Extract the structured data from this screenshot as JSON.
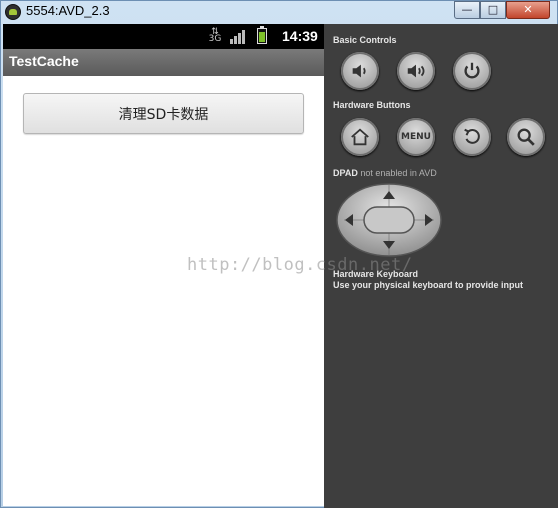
{
  "window": {
    "title": "5554:AVD_2.3",
    "buttons": {
      "minimize": "—",
      "maximize": "□",
      "close": "✕"
    }
  },
  "status_bar": {
    "data_icon": "data-transfer-icon",
    "signal_icon": "signal-icon",
    "battery_icon": "battery-icon",
    "time": "14:39"
  },
  "app": {
    "title": "TestCache",
    "clear_button_label": "清理SD卡数据"
  },
  "controls": {
    "basic_label": "Basic Controls",
    "basic_buttons": [
      "volume-down-icon",
      "volume-up-icon",
      "power-icon"
    ],
    "hardware_label": "Hardware Buttons",
    "menu_label": "MENU",
    "hardware_buttons": [
      "home-icon",
      "menu-icon",
      "back-icon",
      "search-icon"
    ],
    "dpad_label": "DPAD",
    "dpad_note": "not enabled in AVD",
    "keyboard_label": "Hardware Keyboard",
    "keyboard_note": "Use your physical keyboard to provide input"
  },
  "watermark": "http://blog.csdn.net/"
}
